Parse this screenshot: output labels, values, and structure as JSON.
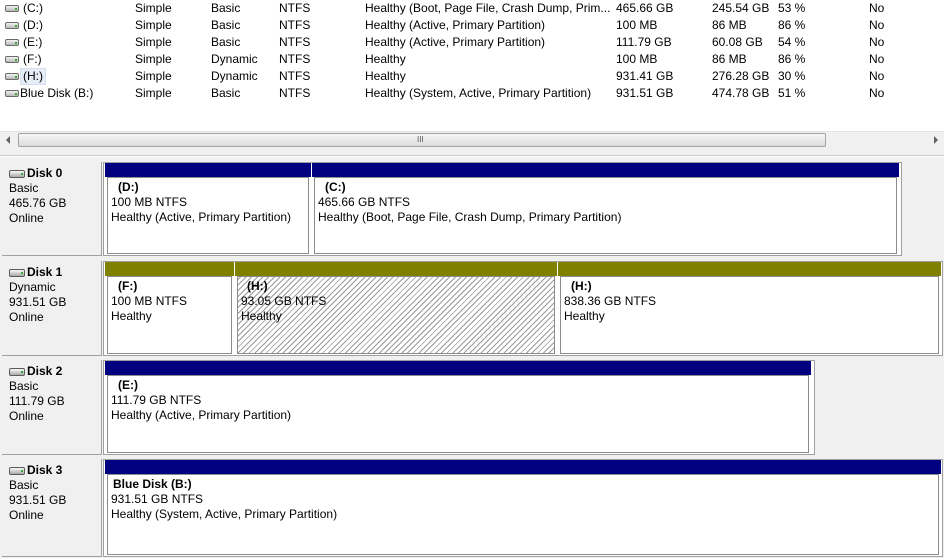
{
  "volumes": [
    {
      "name": "(C:)",
      "layout": "Simple",
      "type": "Basic",
      "fs": "NTFS",
      "status": "Healthy (Boot, Page File, Crash Dump, Prim...",
      "capacity": "465.66 GB",
      "free": "245.54 GB",
      "pct": "53 %",
      "fault": "No",
      "icon": "drive-icon"
    },
    {
      "name": "(D:)",
      "layout": "Simple",
      "type": "Basic",
      "fs": "NTFS",
      "status": "Healthy (Active, Primary Partition)",
      "capacity": "100 MB",
      "free": "86 MB",
      "pct": "86 %",
      "fault": "No",
      "icon": "drive-icon"
    },
    {
      "name": "(E:)",
      "layout": "Simple",
      "type": "Basic",
      "fs": "NTFS",
      "status": "Healthy (Active, Primary Partition)",
      "capacity": "111.79 GB",
      "free": "60.08 GB",
      "pct": "54 %",
      "fault": "No",
      "icon": "drive-icon"
    },
    {
      "name": "(F:)",
      "layout": "Simple",
      "type": "Dynamic",
      "fs": "NTFS",
      "status": "Healthy",
      "capacity": "100 MB",
      "free": "86 MB",
      "pct": "86 %",
      "fault": "No",
      "icon": "drive-icon"
    },
    {
      "name": "(H:)",
      "layout": "Simple",
      "type": "Dynamic",
      "fs": "NTFS",
      "status": "Healthy",
      "capacity": "931.41 GB",
      "free": "276.28 GB",
      "pct": "30 %",
      "fault": "No",
      "icon": "drive-icon"
    },
    {
      "name": "Blue Disk (B:)",
      "layout": "Simple",
      "type": "Basic",
      "fs": "NTFS",
      "status": "Healthy (System, Active, Primary Partition)",
      "capacity": "931.51 GB",
      "free": "474.78 GB",
      "pct": "51 %",
      "fault": "No",
      "icon": "drive-icon"
    }
  ],
  "scrollbar": {
    "grip": "III"
  },
  "colors": {
    "basic_bar": "#000080",
    "dynamic_bar": "#808000"
  },
  "disks": [
    {
      "title": "Disk 0",
      "type": "Basic",
      "size": "465.76 GB",
      "state": "Online",
      "partitions": [
        {
          "title": "(D:)",
          "size": "100 MB NTFS",
          "status": "Healthy (Active, Primary Partition)"
        },
        {
          "title": "(C:)",
          "size": "465.66 GB NTFS",
          "status": "Healthy (Boot, Page File, Crash Dump, Primary Partition)"
        }
      ]
    },
    {
      "title": "Disk 1",
      "type": "Dynamic",
      "size": "931.51 GB",
      "state": "Online",
      "partitions": [
        {
          "title": "(F:)",
          "size": "100 MB NTFS",
          "status": "Healthy"
        },
        {
          "title": "(H:)",
          "size": "93.05 GB NTFS",
          "status": "Healthy"
        },
        {
          "title": "(H:)",
          "size": "838.36 GB NTFS",
          "status": "Healthy"
        }
      ]
    },
    {
      "title": "Disk 2",
      "type": "Basic",
      "size": "111.79 GB",
      "state": "Online",
      "partitions": [
        {
          "title": "(E:)",
          "size": "111.79 GB NTFS",
          "status": "Healthy (Active, Primary Partition)"
        }
      ]
    },
    {
      "title": "Disk 3",
      "type": "Basic",
      "size": "931.51 GB",
      "state": "Online",
      "partitions": [
        {
          "title": "Blue Disk  (B:)",
          "size": "931.51 GB NTFS",
          "status": "Healthy (System, Active, Primary Partition)"
        }
      ]
    }
  ]
}
